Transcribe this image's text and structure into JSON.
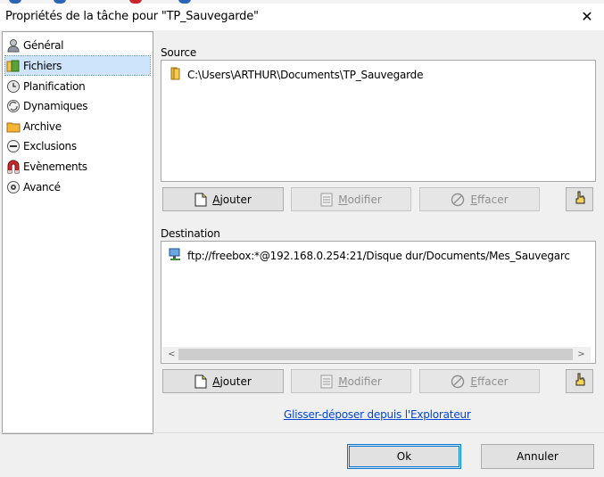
{
  "window": {
    "title": "Propriétés de la tâche pour \"TP_Sauvegarde\"",
    "close_glyph": "✕"
  },
  "sidebar": {
    "items": [
      {
        "label": "Général",
        "icon": "general-icon",
        "selected": false
      },
      {
        "label": "Fichiers",
        "icon": "files-icon",
        "selected": true
      },
      {
        "label": "Planification",
        "icon": "clock-icon",
        "selected": false
      },
      {
        "label": "Dynamiques",
        "icon": "dynamic-icon",
        "selected": false
      },
      {
        "label": "Archive",
        "icon": "archive-folder-icon",
        "selected": false
      },
      {
        "label": "Exclusions",
        "icon": "exclusion-icon",
        "selected": false
      },
      {
        "label": "Evènements",
        "icon": "magnet-icon",
        "selected": false
      },
      {
        "label": "Avancé",
        "icon": "gear-icon",
        "selected": false
      }
    ]
  },
  "source": {
    "label": "Source",
    "entries": [
      {
        "text": "C:\\Users\\ARTHUR\\Documents\\TP_Sauvegarde",
        "icon": "folder-icon"
      }
    ],
    "buttons": {
      "add_first": "A",
      "add_rest": "jouter",
      "modify_first": "M",
      "modify_rest": "odifier",
      "erase_first": "E",
      "erase_rest": "ffacer"
    }
  },
  "destination": {
    "label": "Destination",
    "entries": [
      {
        "text": "ftp://freebox:*@192.168.0.254:21/Disque dur/Documents/Mes_Sauvegarc",
        "icon": "network-computer-icon"
      }
    ],
    "scroll_left": "<",
    "scroll_right": ">",
    "buttons": {
      "add_first": "A",
      "add_rest": "jouter",
      "modify_first": "M",
      "modify_rest": "odifier",
      "erase_first": "E",
      "erase_rest": "ffacer"
    }
  },
  "link_text": "Glisser-déposer depuis l'Explorateur",
  "footer": {
    "ok": "Ok",
    "cancel": "Annuler"
  },
  "colors": {
    "selection": "#cde4fa",
    "link": "#0046d5",
    "default_button_border": "#0078d7",
    "dialog_bg": "#f0f0f0"
  }
}
